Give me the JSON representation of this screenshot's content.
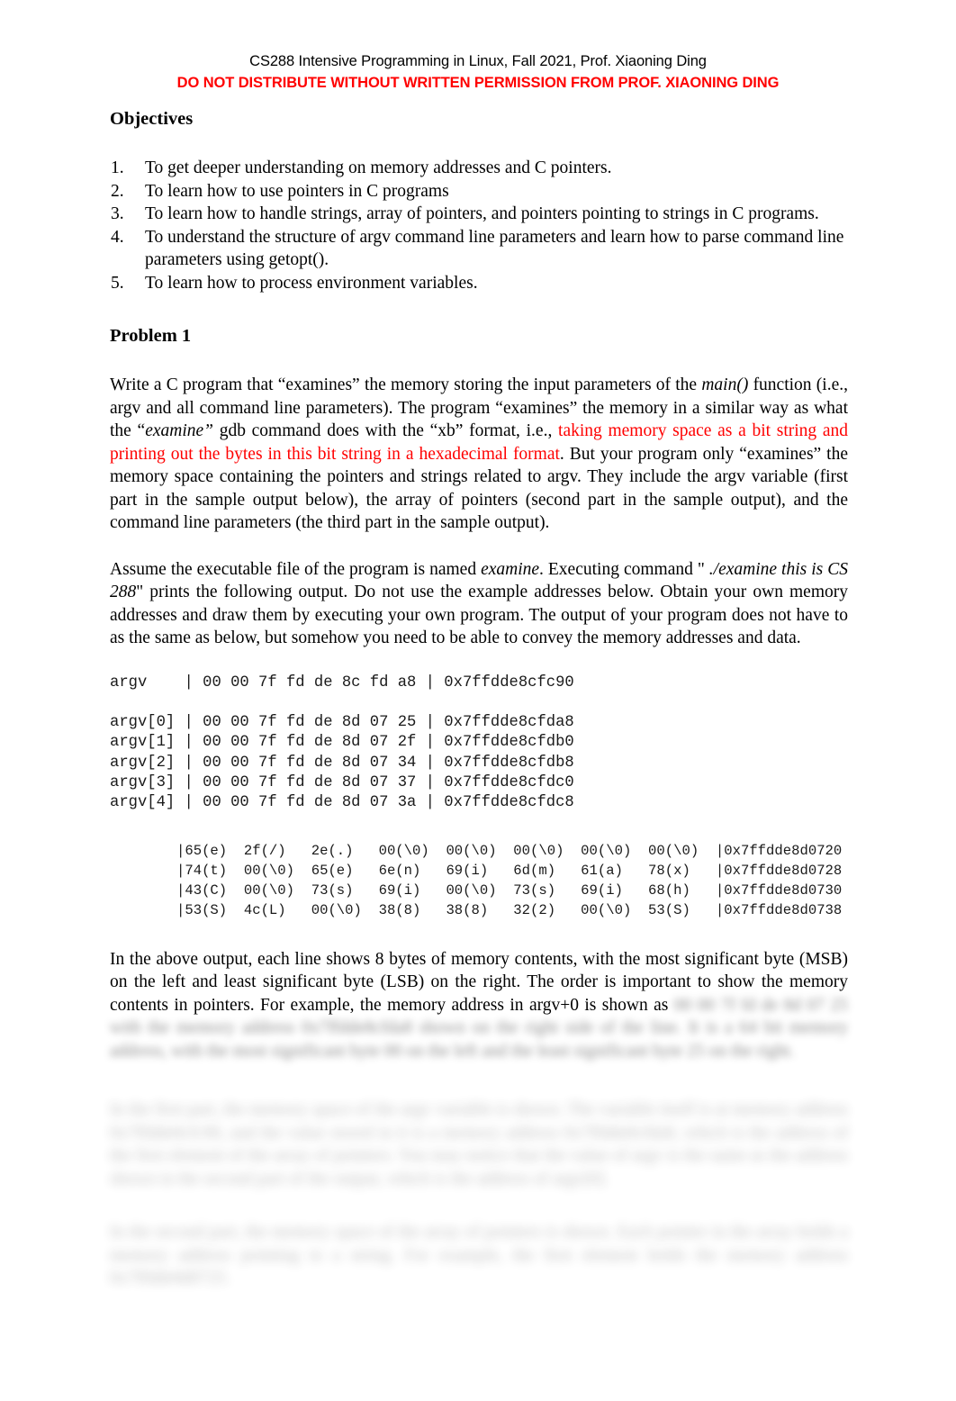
{
  "header": {
    "course_line": "CS288 Intensive Programming in Linux, Fall 2021, Prof. Xiaoning Ding",
    "notice_line": "DO NOT DISTRIBUTE WITHOUT WRITTEN PERMISSION FROM PROF. XIAONING DING",
    "notice_color": "#ff0000"
  },
  "objectives": {
    "title": "Objectives",
    "items": [
      {
        "num": "1.",
        "text": "To get deeper understanding on memory addresses and C pointers."
      },
      {
        "num": "2.",
        "text": "To learn how to use pointers in C programs"
      },
      {
        "num": "3.",
        "text": "To learn how to handle strings, array of pointers, and pointers pointing to strings in C programs."
      },
      {
        "num": "4.",
        "text": "To understand the structure of argv command line parameters and learn how to parse command line parameters using getopt()."
      },
      {
        "num": "5.",
        "text": "To learn how to process environment variables."
      }
    ]
  },
  "problem1": {
    "title": "Problem 1",
    "paragraph1": {
      "part_a": "Write a C program that “examines” the memory storing the input parameters of the ",
      "emph_main": "main()",
      "part_b": " function (i.e., argv and all command line parameters). The program “examines” the memory in a similar way as what the “",
      "emph_examine": "examine”",
      "part_c": " gdb command does with the “xb” format, i.e., ",
      "red_text": "taking memory space as a bit string and printing out the bytes in this bit string in a hexadecimal format",
      "part_d": ". But your program only “examines” the memory space containing the pointers and strings related to argv. They include the argv variable (first part in the sample output below), the array of pointers (second part in the sample output), and the command line parameters (the third part in the sample output)."
    },
    "paragraph2": {
      "part_a": "Assume the executable file of the program is named ",
      "emph_examine": "examine",
      "part_b": ". Executing command \" ",
      "emph_command": "./examine this is CS 288",
      "part_c": "\" prints the following output. Do not use the example addresses below. Obtain your own memory addresses and draw them by executing your own program. The output of your program does not have to as the same as below, but somehow you need to be able to convey the memory addresses and data."
    },
    "code_block_1": "argv    | 00 00 7f fd de 8c fd a8 | 0x7ffdde8cfc90\n\nargv[0] | 00 00 7f fd de 8d 07 25 | 0x7ffdde8cfda8\nargv[1] | 00 00 7f fd de 8d 07 2f | 0x7ffdde8cfdb0\nargv[2] | 00 00 7f fd de 8d 07 34 | 0x7ffdde8cfdb8\nargv[3] | 00 00 7f fd de 8d 07 37 | 0x7ffdde8cfdc0\nargv[4] | 00 00 7f fd de 8d 07 3a | 0x7ffdde8cfdc8",
    "code_block_2": "|65(e)  2f(/)   2e(.)   00(\\0)  00(\\0)  00(\\0)  00(\\0)  00(\\0)  |0x7ffdde8d0720\n|74(t)  00(\\0)  65(e)   6e(n)   69(i)   6d(m)   61(a)   78(x)   |0x7ffdde8d0728\n|43(C)  00(\\0)  73(s)   69(i)   00(\\0)  73(s)   69(i)   68(h)   |0x7ffdde8d0730\n|53(S)  4c(L)   00(\\0)  38(8)   38(8)   32(2)   00(\\0)  53(S)   |0x7ffdde8d0738",
    "paragraph3": {
      "visible_text": "In the above output, each line shows 8 bytes of memory contents, with the most significant byte (MSB) on the left and least significant byte (LSB) on the right. The order is important to show the memory contents in pointers. For example, the memory address in argv+0 is shown as ",
      "redacted_tail": "00 00 7f fd de 8d 07 25 with the memory address 0x7ffdde8cfda8 shown on the right side of the line. It is a 64 bit memory address, with the most significant byte 00 on the left and the least significant byte 25 on the right."
    },
    "paragraph4_redacted": "In the first part, the memory space of the argv variable is shown. The variable itself is at memory address 0x7ffdde8cfc90, and the value stored in it is a memory address 0x7ffdde8cfda8, which is the address of the first element of the array of pointers. You may notice that the value of argv is the same as the address shown in the second part of the output, which is the address of argv[0].",
    "paragraph5_redacted": "In the second part, the memory space of the array of pointers is shown. Each pointer in the array holds a memory address pointing to a string. For example, the first element holds the memory address 0x7ffdde8d0725."
  }
}
